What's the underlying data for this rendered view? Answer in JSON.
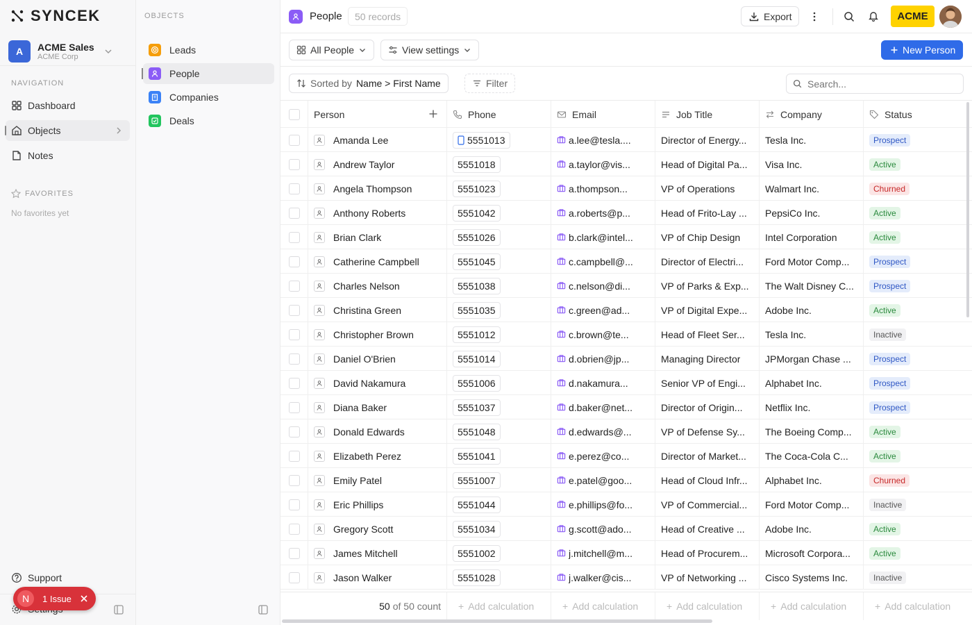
{
  "brand": "SYNCEK",
  "workspace": {
    "initial": "A",
    "name": "ACME Sales",
    "sub": "ACME Corp"
  },
  "nav": {
    "label": "NAVIGATION",
    "items": [
      {
        "label": "Dashboard",
        "icon": "dashboard-icon"
      },
      {
        "label": "Objects",
        "icon": "home-icon"
      },
      {
        "label": "Notes",
        "icon": "notes-icon"
      }
    ],
    "favorites_label": "FAVORITES",
    "favorites_empty": "No favorites yet",
    "support": "Support",
    "settings": "Settings"
  },
  "issue": {
    "avatar": "N",
    "label": "1 Issue"
  },
  "objects": {
    "label": "OBJECTS",
    "items": [
      {
        "label": "Leads",
        "color": "#f59e0b"
      },
      {
        "label": "People",
        "color": "#8b5cf6"
      },
      {
        "label": "Companies",
        "color": "#3b82f6"
      },
      {
        "label": "Deals",
        "color": "#22c55e"
      }
    ]
  },
  "header": {
    "title": "People",
    "count": "50 records",
    "export": "Export",
    "org_badge": "ACME"
  },
  "toolbar": {
    "view": "All People",
    "view_settings": "View settings",
    "new_button": "New Person",
    "sorted_by_label": "Sorted by",
    "sorted_by_value": "Name > First Name",
    "filter": "Filter",
    "search_placeholder": "Search..."
  },
  "columns": [
    "Person",
    "Phone",
    "Email",
    "Job Title",
    "Company",
    "Status"
  ],
  "rows": [
    {
      "name": "Amanda Lee",
      "phone": "5551013",
      "email": "a.lee@tesla....",
      "title": "Director of Energy...",
      "company": "Tesla Inc.",
      "status": "Prospect"
    },
    {
      "name": "Andrew Taylor",
      "phone": "5551018",
      "email": "a.taylor@vis...",
      "title": "Head of Digital Pa...",
      "company": "Visa Inc.",
      "status": "Active"
    },
    {
      "name": "Angela Thompson",
      "phone": "5551023",
      "email": "a.thompson...",
      "title": "VP of Operations",
      "company": "Walmart Inc.",
      "status": "Churned"
    },
    {
      "name": "Anthony Roberts",
      "phone": "5551042",
      "email": "a.roberts@p...",
      "title": "Head of Frito-Lay ...",
      "company": "PepsiCo Inc.",
      "status": "Active"
    },
    {
      "name": "Brian Clark",
      "phone": "5551026",
      "email": "b.clark@intel...",
      "title": "VP of Chip Design",
      "company": "Intel Corporation",
      "status": "Active"
    },
    {
      "name": "Catherine Campbell",
      "phone": "5551045",
      "email": "c.campbell@...",
      "title": "Director of Electri...",
      "company": "Ford Motor Comp...",
      "status": "Prospect"
    },
    {
      "name": "Charles Nelson",
      "phone": "5551038",
      "email": "c.nelson@di...",
      "title": "VP of Parks & Exp...",
      "company": "The Walt Disney C...",
      "status": "Prospect"
    },
    {
      "name": "Christina Green",
      "phone": "5551035",
      "email": "c.green@ad...",
      "title": "VP of Digital Expe...",
      "company": "Adobe Inc.",
      "status": "Active"
    },
    {
      "name": "Christopher Brown",
      "phone": "5551012",
      "email": "c.brown@te...",
      "title": "Head of Fleet Ser...",
      "company": "Tesla Inc.",
      "status": "Inactive"
    },
    {
      "name": "Daniel O'Brien",
      "phone": "5551014",
      "email": "d.obrien@jp...",
      "title": "Managing Director",
      "company": "JPMorgan Chase ...",
      "status": "Prospect"
    },
    {
      "name": "David Nakamura",
      "phone": "5551006",
      "email": "d.nakamura...",
      "title": "Senior VP of Engi...",
      "company": "Alphabet Inc.",
      "status": "Prospect"
    },
    {
      "name": "Diana Baker",
      "phone": "5551037",
      "email": "d.baker@net...",
      "title": "Director of Origin...",
      "company": "Netflix Inc.",
      "status": "Prospect"
    },
    {
      "name": "Donald Edwards",
      "phone": "5551048",
      "email": "d.edwards@...",
      "title": "VP of Defense Sy...",
      "company": "The Boeing Comp...",
      "status": "Active"
    },
    {
      "name": "Elizabeth Perez",
      "phone": "5551041",
      "email": "e.perez@co...",
      "title": "Director of Market...",
      "company": "The Coca-Cola C...",
      "status": "Active"
    },
    {
      "name": "Emily Patel",
      "phone": "5551007",
      "email": "e.patel@goo...",
      "title": "Head of Cloud Infr...",
      "company": "Alphabet Inc.",
      "status": "Churned"
    },
    {
      "name": "Eric Phillips",
      "phone": "5551044",
      "email": "e.phillips@fo...",
      "title": "VP of Commercial...",
      "company": "Ford Motor Comp...",
      "status": "Inactive"
    },
    {
      "name": "Gregory Scott",
      "phone": "5551034",
      "email": "g.scott@ado...",
      "title": "Head of Creative ...",
      "company": "Adobe Inc.",
      "status": "Active"
    },
    {
      "name": "James Mitchell",
      "phone": "5551002",
      "email": "j.mitchell@m...",
      "title": "Head of Procurem...",
      "company": "Microsoft Corpora...",
      "status": "Active"
    },
    {
      "name": "Jason Walker",
      "phone": "5551028",
      "email": "j.walker@cis...",
      "title": "VP of Networking ...",
      "company": "Cisco Systems Inc.",
      "status": "Inactive"
    }
  ],
  "footer": {
    "count_num": "50",
    "count_rest": "of 50 count",
    "add_calc": "Add calculation"
  }
}
